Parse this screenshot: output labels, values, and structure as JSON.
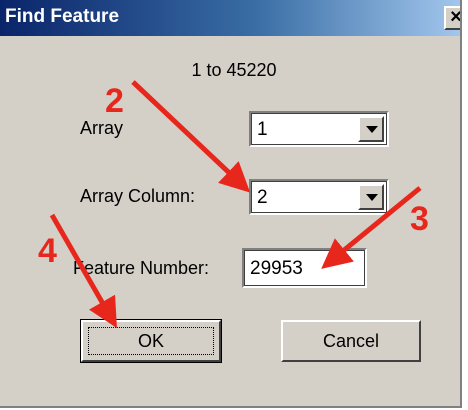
{
  "window": {
    "title": "Find Feature",
    "close_glyph": "×",
    "range": "1 to 45220"
  },
  "fields": {
    "array_label": "Array",
    "array_value": "1",
    "array_column_label": "Array Column:",
    "array_column_value": "2",
    "feature_number_label": "Feature Number:",
    "feature_number_value": "29953"
  },
  "buttons": {
    "ok_label": "OK",
    "cancel_label": "Cancel"
  },
  "annotations": {
    "color": "#e8271c",
    "steps": [
      "2",
      "3",
      "4"
    ]
  },
  "icons": {
    "dropdown": "chevron-down-icon",
    "close": "close-icon"
  }
}
